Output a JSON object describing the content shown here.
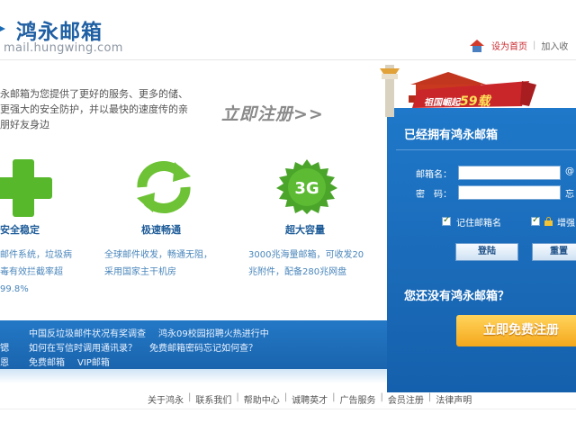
{
  "header": {
    "logo_cn": "鸿永邮箱",
    "logo_en": "mail.hungwing.com",
    "set_home": "设为首页",
    "separator": "|",
    "add_favorite": "加入收"
  },
  "main": {
    "intro": "永邮箱为您提供了更好的服务、更多的储、更强大的安全防护，并以最快的速度传的亲朋好友身边",
    "register_link": "立即注册>>",
    "features": [
      {
        "title": "安全稳定",
        "desc": "邮件系统，垃圾病毒有效拦截率超99.8%"
      },
      {
        "title": "极速畅通",
        "desc": "全球邮件收发，畅通无阻，采用国家主干机房"
      },
      {
        "title": "超大容量",
        "desc": "3000兆海量邮箱，可收发20兆附件，配备280兆网盘"
      }
    ],
    "badge_3g": "3G"
  },
  "news": {
    "rows": [
      [
        "中国反垃圾邮件状况有奖调查",
        "鸿永09校园招聘火热进行中"
      ],
      [
        "如何在写信时调用通讯录？",
        "免费邮箱密码忘记如何查？"
      ],
      [
        "免费邮箱",
        "VIP邮箱"
      ]
    ],
    "bullets": [
      "",
      "锶",
      "恩"
    ]
  },
  "login": {
    "banner_text": "祖国崛起",
    "banner_num": "59载",
    "title": "已经拥有鸿永邮箱",
    "username_label": "邮箱名：",
    "username_value": "",
    "username_suffix": "@",
    "password_label": "密　码：",
    "password_value": "",
    "password_suffix": "忘",
    "remember_label": "记住邮箱名",
    "secure_label": "增强",
    "login_button": "登陆",
    "reset_button": "重置",
    "no_account": "您还没有鸿永邮箱？",
    "free_register": "立即免费注册"
  },
  "footer": {
    "links": [
      "关于鸿永",
      "联系我们",
      "帮助中心",
      "诚聘英才",
      "广告服务",
      "会员注册",
      "法律声明"
    ],
    "separator": "|"
  },
  "colors": {
    "brand_blue": "#1f5fa3",
    "panel_blue": "#1a6bb9",
    "accent_red": "#c9282d",
    "green": "#58b82b",
    "orange": "#f5a71b"
  },
  "icons": [
    "home-icon",
    "plus-icon",
    "refresh-icon",
    "3g-badge-icon",
    "lock-icon",
    "tiananmen-banner-icon"
  ]
}
